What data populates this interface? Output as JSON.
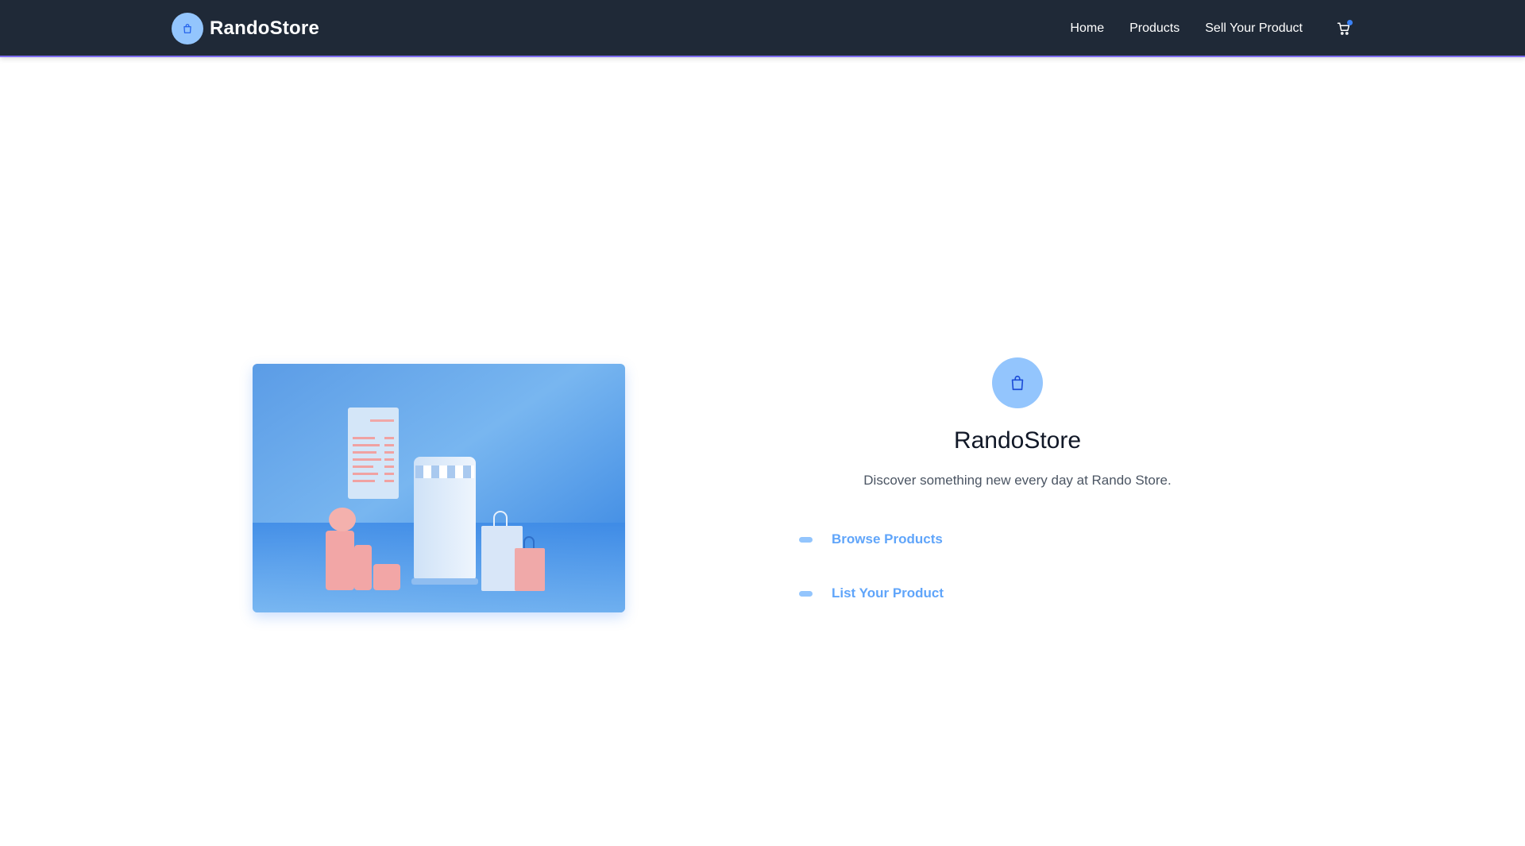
{
  "brand": {
    "name": "RandoStore",
    "logo_icon": "shopping-bag-icon"
  },
  "nav": {
    "links": [
      "Home",
      "Products",
      "Sell Your Product"
    ],
    "cart_icon": "cart-icon"
  },
  "hero": {
    "image": "illustration of a shopping storefront phone, receipt, coins and shopping bags on blue background"
  },
  "panel": {
    "icon": "shopping-bag-icon",
    "title": "RandoStore",
    "subtitle": "Discover something new every day at Rando Store.",
    "actions": [
      "Browse Products",
      "List Your Product"
    ]
  },
  "colors": {
    "navbar_bg": "#1f2937",
    "accent_light": "#93c5fd",
    "link_blue": "#60a5fa",
    "badge_blue": "#3b82f6"
  }
}
